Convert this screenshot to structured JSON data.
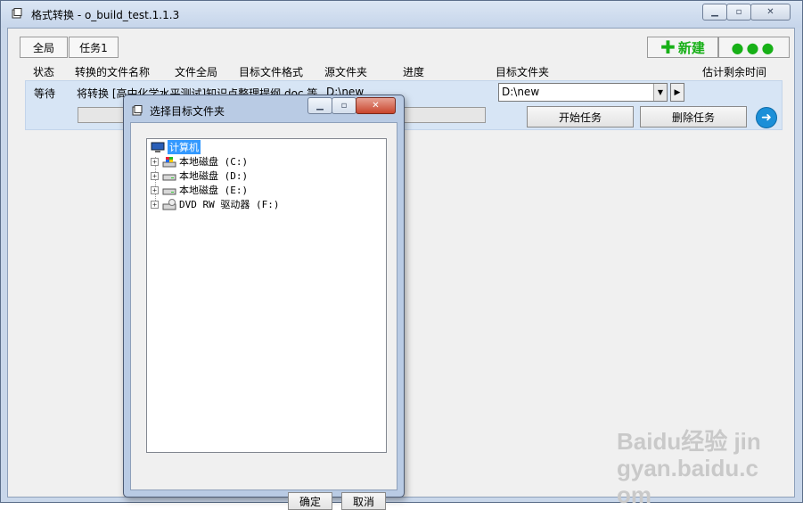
{
  "window": {
    "title": "格式转换 - o_build_test.1.1.3"
  },
  "tabs": [
    "全局",
    "任务1"
  ],
  "toolbar": {
    "new_label": "新建",
    "more_label": "●●●",
    "new_icon": "plus-icon"
  },
  "columns": [
    "状态",
    "转换的文件名称",
    "文件全局",
    "目标文件格式",
    "源文件夹",
    "进度",
    "目标文件夹",
    "估计剩余时间"
  ],
  "task": {
    "status": "等待",
    "name": "将转换 [高中化学水平测试]知识点整理提纲.doc 等",
    "source": "D:\\new",
    "target": "D:\\new",
    "start_label": "开始任务",
    "delete_label": "删除任务"
  },
  "dialog": {
    "title": "选择目标文件夹",
    "root": "计算机",
    "drives": [
      {
        "label": "本地磁盘 (C:)",
        "icon": "system-drive-icon"
      },
      {
        "label": "本地磁盘 (D:)",
        "icon": "hard-drive-icon"
      },
      {
        "label": "本地磁盘 (E:)",
        "icon": "hard-drive-icon"
      },
      {
        "label": "DVD RW 驱动器 (F:)",
        "icon": "dvd-drive-icon"
      }
    ],
    "ok_label": "确定",
    "cancel_label": "取消"
  },
  "watermark": "Baidu经验 jingyan.baidu.com"
}
